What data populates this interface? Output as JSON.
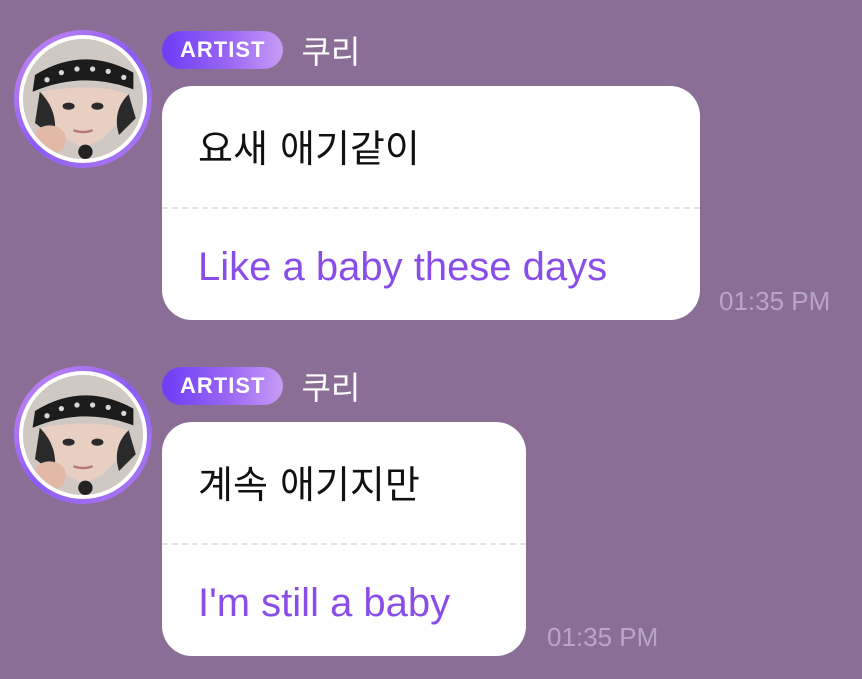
{
  "messages": [
    {
      "badge": "ARTIST",
      "sender": "쿠리",
      "original": "요새 애기같이",
      "translation": "Like a baby these days",
      "time": "01:35 PM"
    },
    {
      "badge": "ARTIST",
      "sender": "쿠리",
      "original": "계속 애기지만",
      "translation": "I'm still a baby",
      "time": "01:35 PM"
    }
  ],
  "colors": {
    "background": "#8b6e96",
    "translation_text": "#8a4ee8",
    "badge_gradient_start": "#6b3df5",
    "badge_gradient_end": "#c79cf5"
  }
}
